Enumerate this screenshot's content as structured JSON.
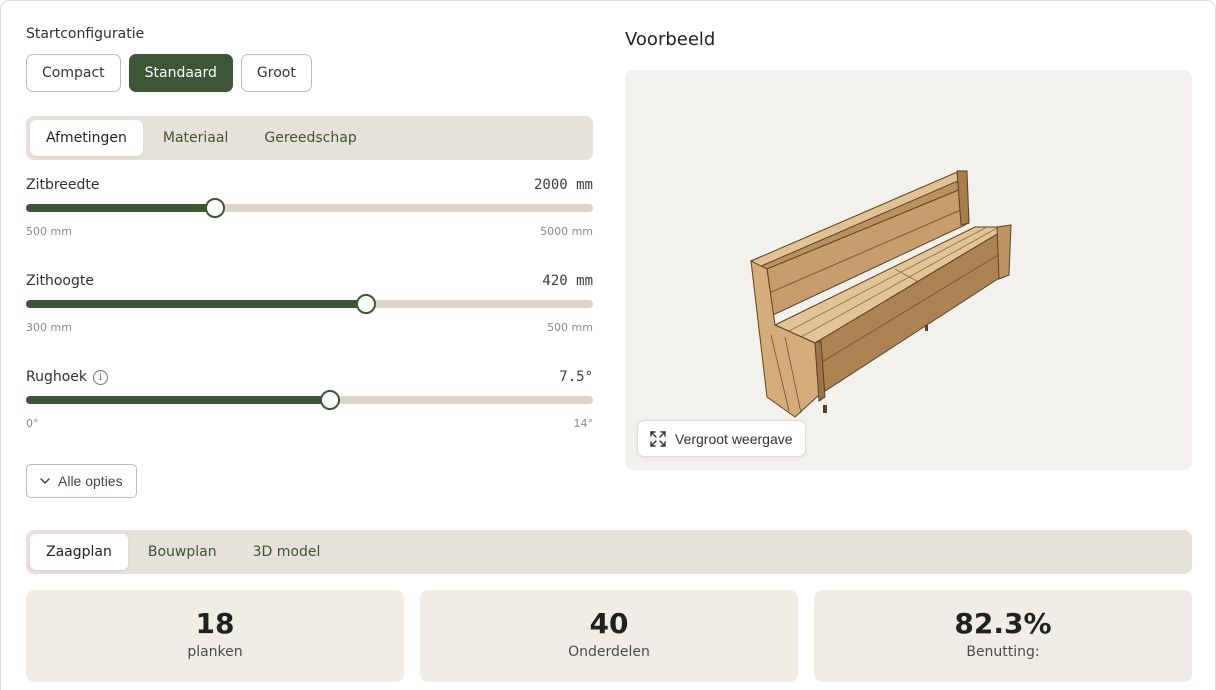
{
  "start_config": {
    "label": "Startconfiguratie",
    "options": [
      "Compact",
      "Standaard",
      "Groot"
    ],
    "selected": "Standaard"
  },
  "settings_tabs": {
    "items": [
      "Afmetingen",
      "Materiaal",
      "Gereedschap"
    ],
    "active": "Afmetingen"
  },
  "sliders": [
    {
      "label": "Zitbreedte",
      "value_text": "2000 mm",
      "min_text": "500 mm",
      "max_text": "5000 mm",
      "fraction": 0.333
    },
    {
      "label": "Zithoogte",
      "value_text": "420 mm",
      "min_text": "300 mm",
      "max_text": "500 mm",
      "fraction": 0.6
    },
    {
      "label": "Rughoek",
      "value_text": "7.5°",
      "min_text": "0°",
      "max_text": "14°",
      "fraction": 0.536,
      "info_icon": "info-icon"
    }
  ],
  "all_options_label": "Alle opties",
  "preview": {
    "title": "Voorbeeld",
    "enlarge_label": "Vergroot weergave"
  },
  "output_tabs": {
    "items": [
      "Zaagplan",
      "Bouwplan",
      "3D model"
    ],
    "active": "Zaagplan"
  },
  "stats": [
    {
      "value": "18",
      "label": "planken"
    },
    {
      "value": "40",
      "label": "Onderdelen"
    },
    {
      "value": "82.3%",
      "label": "Benutting:"
    }
  ],
  "colors": {
    "accent": "#3d5636",
    "track": "#d9d5cb",
    "panel": "#efede6",
    "wood_light": "#d8b88a",
    "wood_mid": "#c49a68",
    "wood_dark": "#a97f50"
  }
}
